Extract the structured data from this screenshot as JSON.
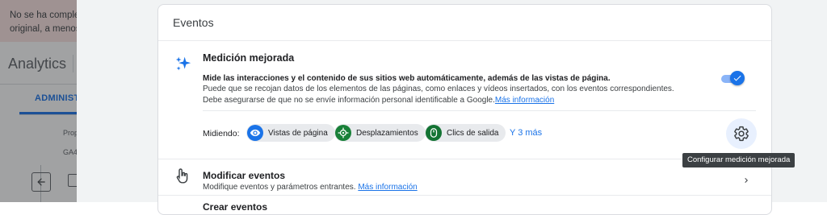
{
  "background": {
    "banner_lines": [
      "No se ha comple",
      "original, a menos"
    ],
    "app_title": "Analytics",
    "admin_tab": "ADMINIST",
    "prop_label": "Prop",
    "ga_label": "GA4"
  },
  "events_card": {
    "title": "Eventos",
    "enhanced_measurement": {
      "title": "Medición mejorada",
      "lead": "Mide las interacciones y el contenido de sus sitios web automáticamente, además de las vistas de página.",
      "description": "Puede que se recojan datos de los elementos de las páginas, como enlaces y vídeos insertados, con los eventos correspondientes. Debe asegurarse de que no se envíe información personal identificable a Google.",
      "learn_more": "Más información",
      "enabled": true
    },
    "measuring": {
      "label": "Midiendo:",
      "chips": [
        {
          "label": "Vistas de página",
          "icon": "eye-icon"
        },
        {
          "label": "Desplazamientos",
          "icon": "crosshair-icon"
        },
        {
          "label": "Clics de salida",
          "icon": "mouse-icon"
        }
      ],
      "more": "Y 3 más"
    },
    "settings_tooltip": "Configurar medición mejorada",
    "modify_events": {
      "title": "Modificar eventos",
      "description": "Modifique eventos y parámetros entrantes.",
      "learn_more": "Más información"
    },
    "next_row_title": "Crear eventos"
  },
  "colors": {
    "accent": "#1a73e8",
    "chip_bg": "#e8eaed",
    "gear_bg": "#e8f0fe"
  }
}
